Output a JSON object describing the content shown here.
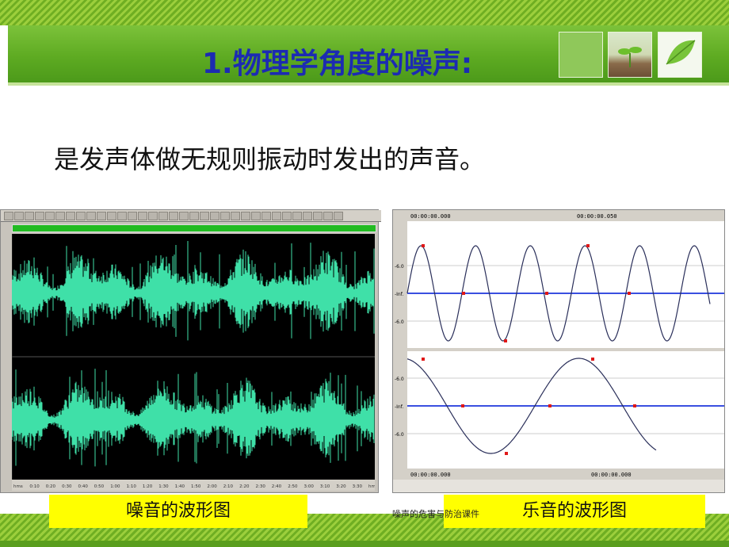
{
  "slide": {
    "title": "1.物理学角度的噪声:",
    "subtitle": "是发声体做无规则振动时发出的声音。",
    "footer": "噪声的危害与防治课件"
  },
  "left_panel": {
    "caption": "噪音的波形图",
    "timeline_labels": [
      "hms",
      "0:10",
      "0:20",
      "0:30",
      "0:40",
      "0:50",
      "1:00",
      "1:10",
      "1:20",
      "1:30",
      "1:40",
      "1:50",
      "2:00",
      "2:10",
      "2:20",
      "2:30",
      "2:40",
      "2:50",
      "3:00",
      "3:10",
      "3:20",
      "3:30",
      "hms"
    ]
  },
  "right_panel": {
    "caption": "乐音的波形图",
    "top_time_start": "00:00:00.000",
    "top_time_mid": "00:00:00.050",
    "bottom_time_start": "00:00:00.000",
    "bottom_time_mid": "00:00:00.000",
    "y_labels_top": [
      "-6.0",
      "-Inf.",
      "-6.0"
    ],
    "y_labels_bottom": [
      "-6.0",
      "-Inf.",
      "-6.0"
    ]
  },
  "colors": {
    "title": "#1c2bb2",
    "noise_wave": "#3fe0a8",
    "sine_axis": "#3a4fe0",
    "marker": "#e01818",
    "caption_bg": "#ffff00"
  }
}
